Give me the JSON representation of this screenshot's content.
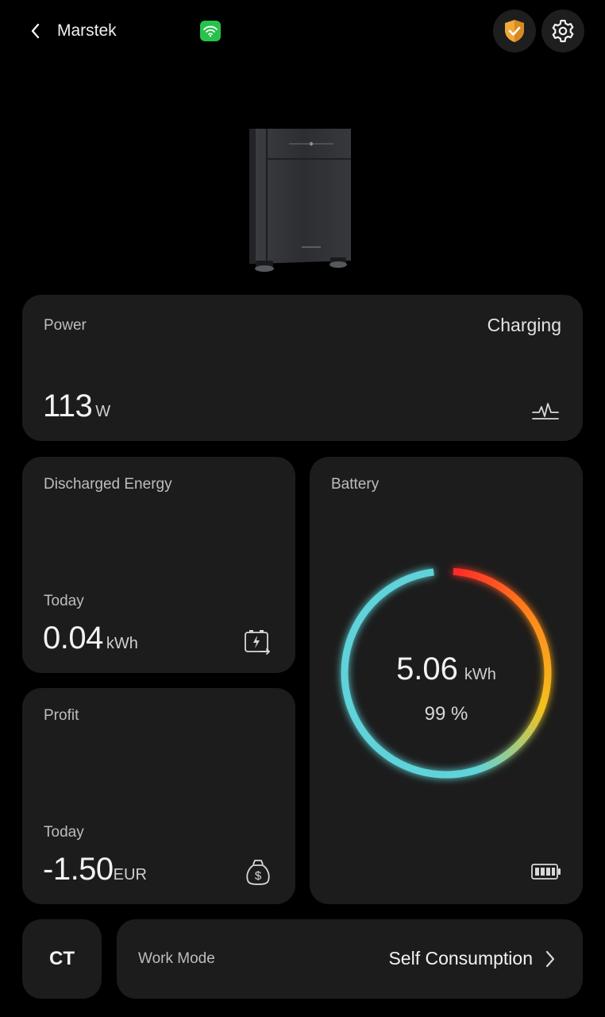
{
  "header": {
    "title": "Marstek",
    "icons": {
      "back": "chevron-left-icon",
      "wifi": "wifi-icon",
      "shield": "shield-check-icon",
      "settings": "gear-icon"
    },
    "wifi_color": "#27c24c",
    "shield_color": "#f0a93a"
  },
  "power": {
    "label": "Power",
    "status": "Charging",
    "value": "113",
    "unit": "W",
    "icon": "waveform-icon"
  },
  "discharged": {
    "label": "Discharged Energy",
    "period": "Today",
    "value": "0.04",
    "unit": "kWh",
    "icon": "battery-discharge-icon"
  },
  "profit": {
    "label": "Profit",
    "period": "Today",
    "value": "-1.50",
    "unit": "EUR",
    "icon": "money-bag-icon"
  },
  "battery": {
    "label": "Battery",
    "energy": "5.06",
    "energy_unit": "kWh",
    "percent_text": "99 %",
    "percent": 99,
    "icon": "battery-full-icon",
    "ring_colors": [
      "#ff2a2a",
      "#ff8a1a",
      "#f2c21a",
      "#5fd3d9"
    ]
  },
  "ct": {
    "label": "CT"
  },
  "work_mode": {
    "label": "Work Mode",
    "value": "Self Consumption",
    "icon": "chevron-right-icon"
  }
}
